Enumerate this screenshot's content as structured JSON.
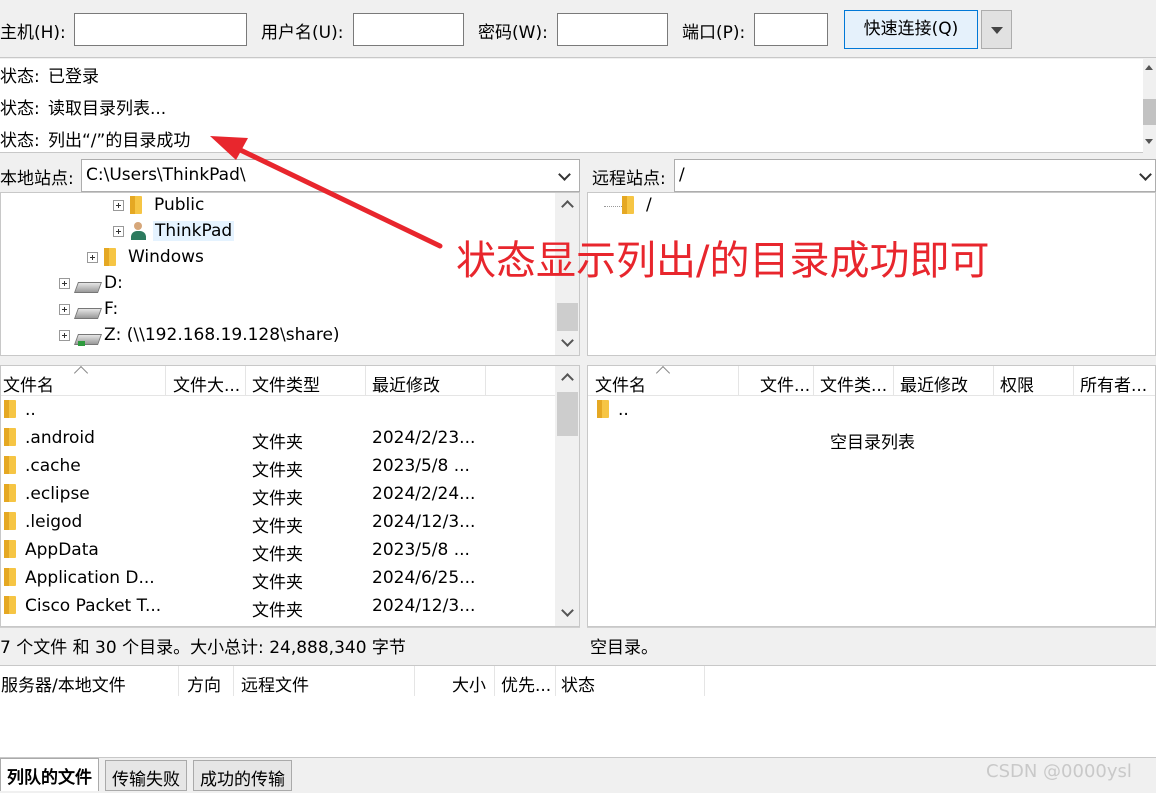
{
  "quickconnect": {
    "host_label": "主机(H):",
    "host_value": "",
    "user_label": "用户名(U):",
    "user_value": "",
    "pass_label": "密码(W):",
    "pass_value": "",
    "port_label": "端口(P):",
    "port_value": "",
    "connect_label": "快速连接(Q)"
  },
  "log": [
    {
      "key": "状态:",
      "text": "已登录"
    },
    {
      "key": "状态:",
      "text": "读取目录列表..."
    },
    {
      "key": "状态:",
      "text": "列出“/”的目录成功"
    }
  ],
  "local": {
    "site_label": "本地站点:",
    "path": "C:\\Users\\ThinkPad\\",
    "tree": [
      {
        "label": "Public",
        "icon": "folder-icon"
      },
      {
        "label": "ThinkPad",
        "icon": "user-folder-icon"
      },
      {
        "label": "Windows",
        "icon": "folder-icon"
      },
      {
        "label": "D:",
        "icon": "drive-icon"
      },
      {
        "label": "F:",
        "icon": "drive-icon"
      },
      {
        "label": "Z: (\\\\192.168.19.128\\share)",
        "icon": "network-drive-icon"
      }
    ],
    "columns": [
      "文件名",
      "文件大...",
      "文件类型",
      "最近修改"
    ],
    "files": [
      {
        "name": "..",
        "size": "",
        "type": "",
        "modified": ""
      },
      {
        "name": ".android",
        "size": "",
        "type": "文件夹",
        "modified": "2024/2/23..."
      },
      {
        "name": ".cache",
        "size": "",
        "type": "文件夹",
        "modified": "2023/5/8 ..."
      },
      {
        "name": ".eclipse",
        "size": "",
        "type": "文件夹",
        "modified": "2024/2/24..."
      },
      {
        "name": ".leigod",
        "size": "",
        "type": "文件夹",
        "modified": "2024/12/3..."
      },
      {
        "name": "AppData",
        "size": "",
        "type": "文件夹",
        "modified": "2023/5/8 ..."
      },
      {
        "name": "Application D...",
        "size": "",
        "type": "文件夹",
        "modified": "2024/6/25..."
      },
      {
        "name": "Cisco Packet T...",
        "size": "",
        "type": "文件夹",
        "modified": "2024/12/3..."
      }
    ],
    "status": "7 个文件 和 30 个目录。大小总计: 24,888,340 字节"
  },
  "remote": {
    "site_label": "远程站点:",
    "path": "/",
    "tree": [
      {
        "label": "/",
        "icon": "folder-icon"
      }
    ],
    "columns": [
      "文件名",
      "文件...",
      "文件类...",
      "最近修改",
      "权限",
      "所有者..."
    ],
    "files": [
      {
        "name": ".."
      }
    ],
    "empty_text": "空目录列表",
    "status": "空目录。"
  },
  "queue": {
    "columns": [
      "服务器/本地文件",
      "方向",
      "远程文件",
      "大小",
      "优先...",
      "状态"
    ]
  },
  "tabs": [
    "列队的文件",
    "传输失败",
    "成功的传输"
  ],
  "annotation": {
    "text": "状态显示列出/的目录成功即可",
    "color": "#e8262d"
  },
  "watermark": "CSDN @0000ysl"
}
